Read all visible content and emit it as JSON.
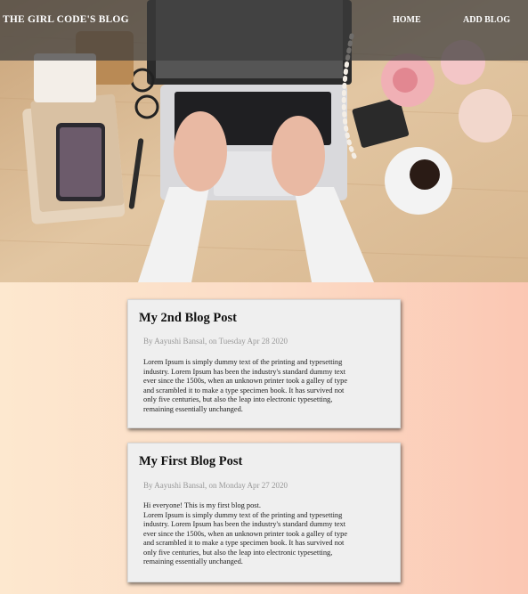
{
  "header": {
    "brand": "THE GIRL CODE'S BLOG",
    "nav": [
      {
        "label": "HOME"
      },
      {
        "label": "ADD BLOG"
      }
    ]
  },
  "posts": [
    {
      "title": "My 2nd Blog Post",
      "meta": "By Aayushi Bansal, on Tuesday Apr 28 2020",
      "lines": [
        "Lorem Ipsum is simply dummy text of the printing and typesetting",
        "industry. Lorem Ipsum has been the industry's standard dummy text",
        "ever since the 1500s, when an unknown printer took a galley of type",
        "and scrambled it to make a type specimen book. It has survived not",
        "only five centuries, but also the leap into electronic typesetting,",
        "remaining essentially unchanged."
      ]
    },
    {
      "title": "My First Blog Post",
      "meta": "By Aayushi Bansal, on Monday Apr 27 2020",
      "lines": [
        "Hi everyone! This is my first blog post.",
        "Lorem Ipsum is simply dummy text of the printing and typesetting",
        "industry. Lorem Ipsum has been the industry's standard dummy text",
        "ever since the 1500s, when an unknown printer took a galley of type",
        "and scrambled it to make a type specimen book. It has survived not",
        "only five centuries, but also the leap into electronic typesetting,",
        "remaining essentially unchanged."
      ]
    }
  ]
}
